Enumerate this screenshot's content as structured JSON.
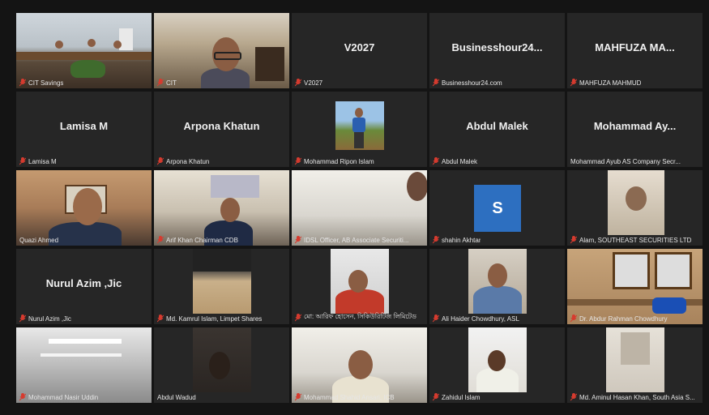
{
  "colors": {
    "active_border": "#e3d24a",
    "mic_muted": "#d63b2f",
    "avatar_bg": "#2d6fc0"
  },
  "tiles": [
    {
      "kind": "video",
      "footer": "CIT Savings",
      "muted": true
    },
    {
      "kind": "video",
      "footer": "CIT",
      "muted": true
    },
    {
      "kind": "name",
      "label": "V2027",
      "footer": "V2027",
      "muted": true
    },
    {
      "kind": "name",
      "label": "Businesshour24...",
      "footer": "Businesshour24.com",
      "muted": true
    },
    {
      "kind": "name",
      "label": "MAHFUZA MA...",
      "footer": "MAHFUZA MAHMUD",
      "muted": true
    },
    {
      "kind": "name",
      "label": "Lamisa M",
      "footer": "Lamisa M",
      "muted": true
    },
    {
      "kind": "name",
      "label": "Arpona Khatun",
      "footer": "Arpona Khatun",
      "muted": true
    },
    {
      "kind": "photo",
      "footer": "Mohammad Ripon Islam",
      "muted": true
    },
    {
      "kind": "name",
      "label": "Abdul Malek",
      "footer": "Abdul Malek",
      "muted": true
    },
    {
      "kind": "name",
      "label": "Mohammad  Ay...",
      "footer": "Mohammad Ayub AS Company Secr...",
      "muted": false
    },
    {
      "kind": "video",
      "footer": "Quazi Ahmed",
      "muted": false,
      "active": true
    },
    {
      "kind": "video",
      "footer": "Arif Khan Chairman CDB",
      "muted": true
    },
    {
      "kind": "video",
      "footer": "IDSL Officer, AB Associate Securiti...",
      "muted": true
    },
    {
      "kind": "avatar",
      "avatar_letter": "S",
      "footer": "shahin Akhtar",
      "muted": true
    },
    {
      "kind": "video",
      "footer": "Alam, SOUTHEAST SECURITIES LTD",
      "muted": true
    },
    {
      "kind": "name",
      "label": "Nurul Azim ,Jic",
      "footer": "Nurul Azim ,Jic",
      "muted": true
    },
    {
      "kind": "video",
      "footer": "Md. Kamrul Islam, Limpet Shares",
      "muted": true
    },
    {
      "kind": "video",
      "footer": "মো: আরিফ হোসেন, সিকিউরিটিজ লিমিটেড",
      "muted": true
    },
    {
      "kind": "video",
      "footer": "Ali Haider Chowdhury, ASL",
      "muted": true
    },
    {
      "kind": "video",
      "footer": "Dr. Abdur Rahman Chowdhury",
      "muted": true
    },
    {
      "kind": "video",
      "footer": "Mohammad Nasir Uddin",
      "muted": true
    },
    {
      "kind": "video",
      "footer": "Abdul Wadud",
      "muted": false
    },
    {
      "kind": "video",
      "footer": "Mohammad Shahid Ansari, ICB",
      "muted": true
    },
    {
      "kind": "video",
      "footer": "Zahidul Islam",
      "muted": true
    },
    {
      "kind": "video",
      "footer": "Md. Aminul Hasan Khan, South Asia S...",
      "muted": true
    }
  ]
}
